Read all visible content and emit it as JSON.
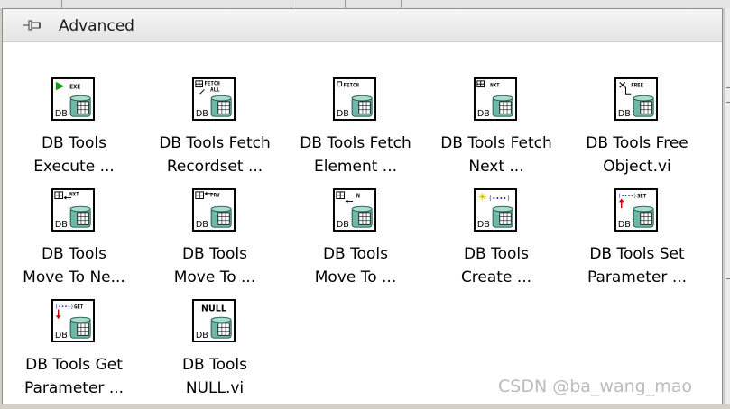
{
  "palette": {
    "title": "Advanced",
    "items": [
      {
        "line1": "DB Tools",
        "line2": "Execute ...",
        "glyph": "EXE",
        "icon": "execute-icon"
      },
      {
        "line1": "DB Tools Fetch",
        "line2": "Recordset ...",
        "glyph": "FETCH ALL",
        "icon": "fetch-recordset-icon"
      },
      {
        "line1": "DB Tools Fetch",
        "line2": "Element ...",
        "glyph": "FETCH",
        "icon": "fetch-element-icon"
      },
      {
        "line1": "DB Tools Fetch",
        "line2": "Next ...",
        "glyph": "NXT",
        "icon": "fetch-next-icon"
      },
      {
        "line1": "DB Tools Free",
        "line2": "Object.vi",
        "glyph": "FREE",
        "icon": "free-object-icon"
      },
      {
        "line1": "DB Tools",
        "line2": "Move To Ne...",
        "glyph": "NXT",
        "icon": "move-to-next-icon"
      },
      {
        "line1": "DB Tools",
        "line2": "Move To ...",
        "glyph": "PRV",
        "icon": "move-to-previous-icon"
      },
      {
        "line1": "DB Tools",
        "line2": "Move To ...",
        "glyph": "N",
        "icon": "move-to-n-icon"
      },
      {
        "line1": "DB Tools",
        "line2": "Create ...",
        "glyph": "",
        "icon": "create-parameter-icon"
      },
      {
        "line1": "DB Tools Set",
        "line2": "Parameter ...",
        "glyph": "SET",
        "icon": "set-parameter-icon"
      },
      {
        "line1": "DB Tools Get",
        "line2": "Parameter ...",
        "glyph": "GET",
        "icon": "get-parameter-icon"
      },
      {
        "line1": "DB Tools",
        "line2": "NULL.vi",
        "glyph": "NULL",
        "icon": "null-icon"
      }
    ],
    "db_label": "DB"
  },
  "watermark": "CSDN @ba_wang_mao"
}
